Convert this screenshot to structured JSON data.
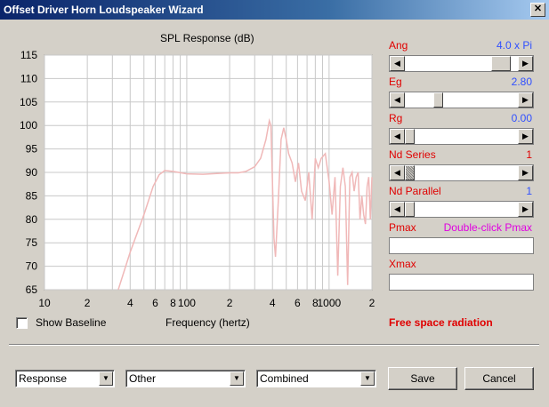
{
  "window": {
    "title": "Offset Driver Horn Loudspeaker Wizard",
    "close_glyph": "✕"
  },
  "chart_title": "SPL Response (dB)",
  "params": [
    {
      "name": "Ang",
      "value": "4.0 x Pi",
      "slider_fraction": 0.85
    },
    {
      "name": "Eg",
      "value": "2.80",
      "slider_fraction": 0.28
    },
    {
      "name": "Rg",
      "value": "0.00",
      "slider_fraction": 0.0
    },
    {
      "name": "Nd  Series",
      "value": "1",
      "slider_fraction": 0.0
    },
    {
      "name": "Nd  Parallel",
      "value": "1",
      "slider_fraction": 0.0
    },
    {
      "name": "Pmax",
      "value": "Double-click Pmax"
    },
    {
      "name": "Xmax",
      "value": ""
    }
  ],
  "show_baseline": {
    "label": "Show Baseline",
    "checked": false
  },
  "xaxis_title": "Frequency (hertz)",
  "status_text": "Free space radiation",
  "dropdowns": [
    {
      "name": "view-select",
      "value": "Response"
    },
    {
      "name": "other-select",
      "value": "Other"
    },
    {
      "name": "driver-select",
      "value": "Combined"
    }
  ],
  "buttons": {
    "save": "Save",
    "cancel": "Cancel"
  },
  "colors": {
    "curve": "#f0b8b8",
    "grid": "#c8c8c8",
    "param_name": "#e00000",
    "param_value": "#3050ff",
    "pmax_value": "#e000e0"
  },
  "chart_data": {
    "type": "line",
    "title": "SPL Response (dB)",
    "xlabel": "Frequency (hertz)",
    "ylabel": "",
    "x_scale": "log",
    "xlim": [
      10,
      2000
    ],
    "ylim": [
      65,
      115
    ],
    "y_ticks": [
      "115",
      "110",
      "105",
      "100",
      "95",
      "90",
      "85",
      "80",
      "75",
      "70",
      "65"
    ],
    "x_ticks": [
      {
        "v": 10,
        "label": "10"
      },
      {
        "v": 20,
        "label": "2"
      },
      {
        "v": 40,
        "label": "4"
      },
      {
        "v": 60,
        "label": "6"
      },
      {
        "v": 80,
        "label": "8"
      },
      {
        "v": 100,
        "label": "100"
      },
      {
        "v": 200,
        "label": "2"
      },
      {
        "v": 400,
        "label": "4"
      },
      {
        "v": 600,
        "label": "6"
      },
      {
        "v": 800,
        "label": "8"
      },
      {
        "v": 1000,
        "label": "1000"
      },
      {
        "v": 2000,
        "label": "2"
      }
    ],
    "series": [
      {
        "x": [
          33,
          40,
          50,
          58,
          64,
          70,
          80,
          100,
          130,
          200,
          230,
          260,
          300,
          330,
          360,
          380,
          390,
          400,
          410,
          420,
          440,
          460,
          480,
          500,
          520,
          550,
          580,
          610,
          640,
          680,
          720,
          760,
          800,
          840,
          880,
          940,
          1000,
          1050,
          1100,
          1150,
          1200,
          1250,
          1300,
          1350,
          1400,
          1450,
          1500,
          1550,
          1600,
          1650,
          1700,
          1750,
          1800,
          1850,
          1900,
          1950,
          2000
        ],
        "y": [
          65,
          73,
          81,
          87,
          89.5,
          90.4,
          90.2,
          89.7,
          89.6,
          89.9,
          89.9,
          90.2,
          91.2,
          93,
          97,
          101,
          100,
          88,
          76,
          72,
          84,
          97,
          99.5,
          97,
          94,
          92,
          88,
          92,
          86,
          84,
          90,
          80,
          93,
          91,
          93,
          94,
          88,
          81,
          89,
          68,
          87,
          91,
          87,
          66,
          89,
          90,
          86,
          89,
          90,
          80,
          85,
          81,
          79,
          87,
          89,
          80,
          89
        ]
      }
    ]
  }
}
